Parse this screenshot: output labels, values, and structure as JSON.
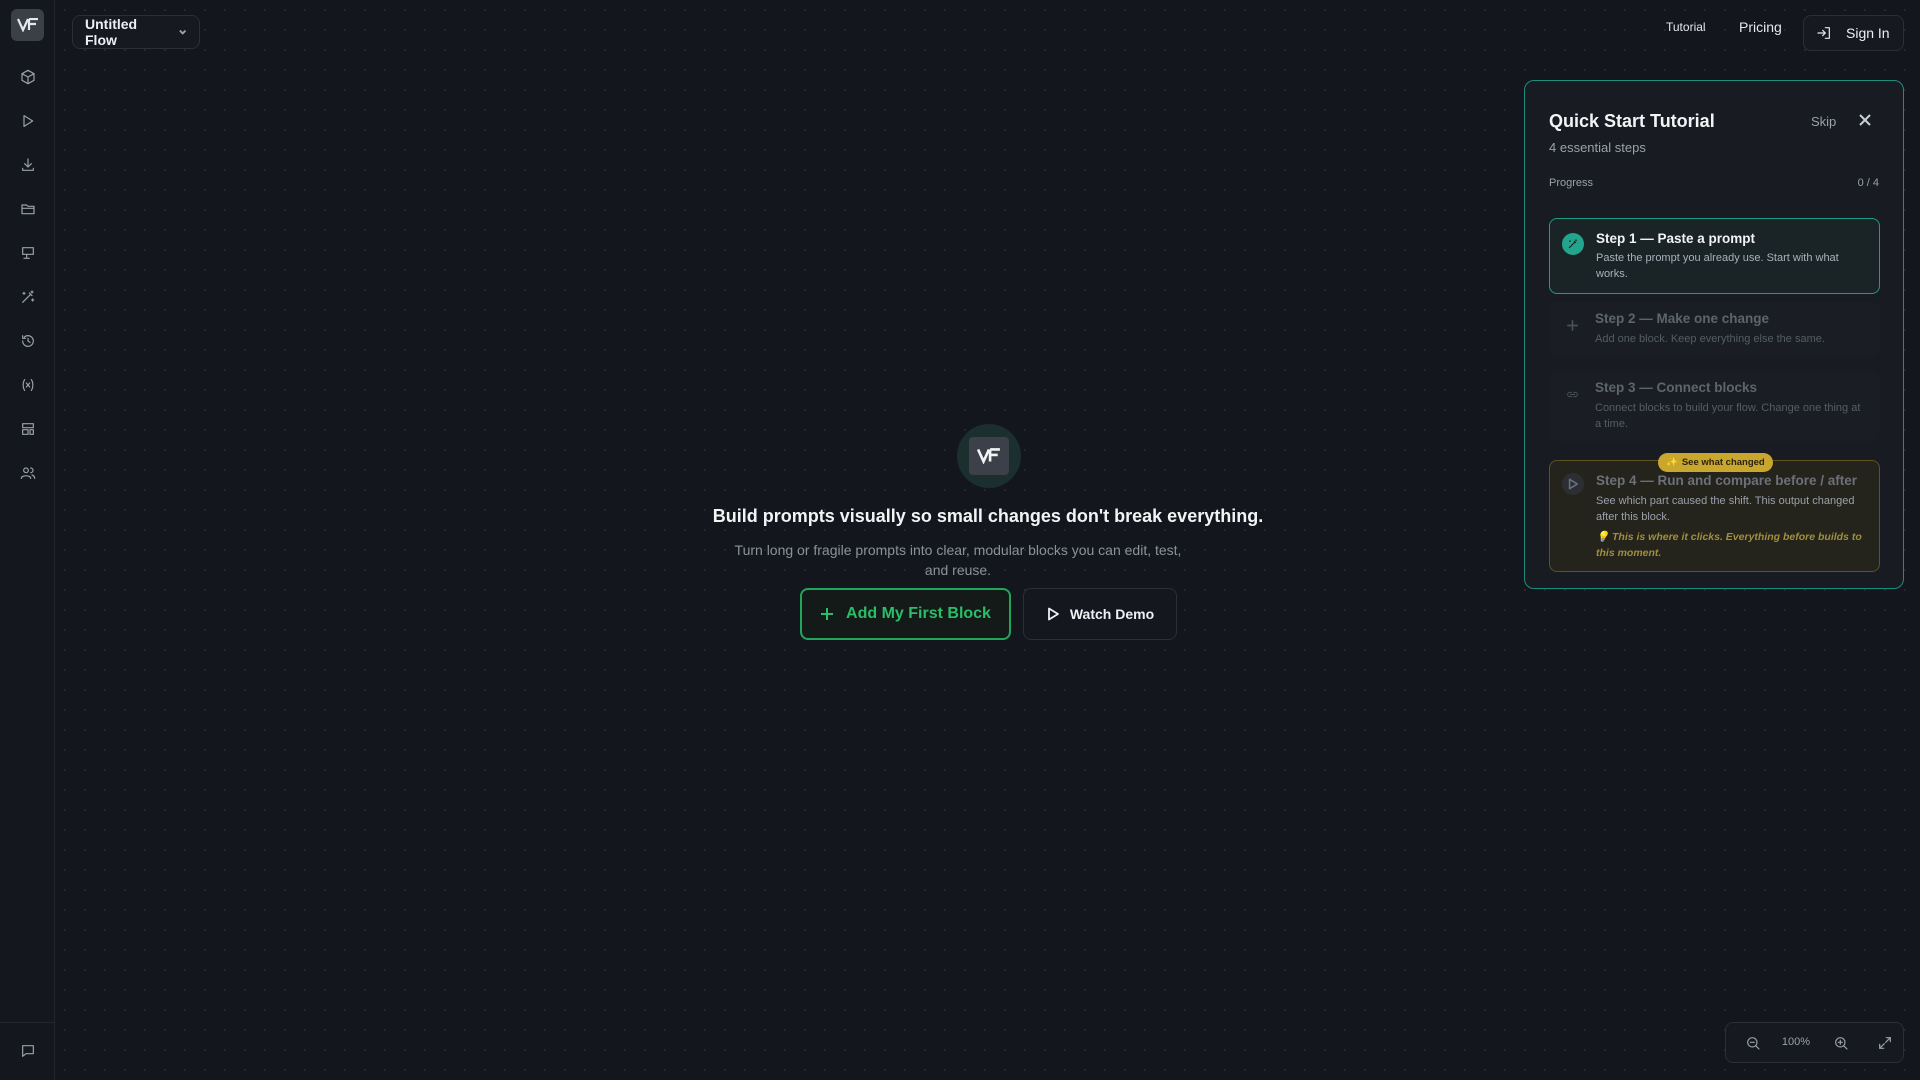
{
  "header": {
    "flow_name": "Untitled Flow",
    "tutorial_link": "Tutorial",
    "pricing_link": "Pricing",
    "signin_label": "Sign In"
  },
  "sidebar": {
    "items": [
      {
        "icon": "cube-icon"
      },
      {
        "icon": "play-icon"
      },
      {
        "icon": "download-icon"
      },
      {
        "icon": "folder-icon"
      },
      {
        "icon": "presentation-icon"
      },
      {
        "icon": "magic-wand-icon"
      },
      {
        "icon": "history-icon"
      },
      {
        "icon": "variable-icon"
      },
      {
        "icon": "layout-icon"
      },
      {
        "icon": "users-icon"
      }
    ],
    "bottom_icon": "chat-icon"
  },
  "main": {
    "headline": "Build prompts visually so small changes don't break everything.",
    "subline": "Turn long or fragile prompts into clear, modular blocks you can edit, test, and reuse.",
    "add_block_label": "Add My First Block",
    "watch_demo_label": "Watch Demo"
  },
  "tutorial": {
    "title": "Quick Start Tutorial",
    "subtitle": "4 essential steps",
    "skip_label": "Skip",
    "progress_label": "Progress",
    "progress_count": "0 / 4",
    "progress_value": 0,
    "badge": "See what changed",
    "steps": [
      {
        "title": "Step 1 — Paste a prompt",
        "desc": "Paste the prompt you already use. Start with what works."
      },
      {
        "title": "Step 2 — Make one change",
        "desc": "Add one block. Keep everything else the same."
      },
      {
        "title": "Step 3 — Connect blocks",
        "desc": "Connect blocks to build your flow. Change one thing at a time."
      },
      {
        "title": "Step 4 — Run and compare before / after",
        "desc": "See which part caused the shift. This output changed after this block.",
        "note": "This is where it clicks. Everything before builds to this moment."
      }
    ]
  },
  "zoom": {
    "level": "100%"
  },
  "colors": {
    "accent_green": "#2bbd68",
    "accent_teal": "#1e9c87",
    "badge_yellow": "#c9a72f"
  }
}
